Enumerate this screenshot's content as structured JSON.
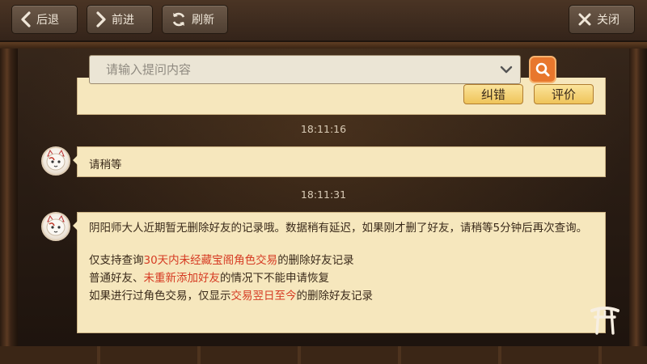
{
  "toolbar": {
    "back_label": "后退",
    "forward_label": "前进",
    "refresh_label": "刷新",
    "close_label": "关闭"
  },
  "search": {
    "placeholder": "请输入提问内容"
  },
  "top_card": {
    "correct_label": "纠错",
    "rate_label": "评价"
  },
  "messages": [
    {
      "time": "18:11:16",
      "text": "请稍等"
    },
    {
      "time": "18:11:31",
      "intro": "阴阳师大人近期暂无删除好友的记录哦。数据稍有延迟，如果刚才删了好友，请稍等5分钟后再次查询。",
      "line1": {
        "pre": "仅支持查询",
        "highlight": "30天内未经藏宝阁角色交易",
        "post": "的删除好友记录"
      },
      "line2": {
        "pre": "普通好友、",
        "highlight": "未重新添加好友",
        "post": "的情况下不能申请恢复"
      },
      "line3": {
        "pre": "如果进行过角色交易，仅显示",
        "highlight": "交易翌日至今",
        "post": "的删除好友记录"
      }
    }
  ],
  "colors": {
    "accent_orange": "#e8772d",
    "highlight_red": "#d63b23",
    "card_bg": "#f6e7bd"
  }
}
